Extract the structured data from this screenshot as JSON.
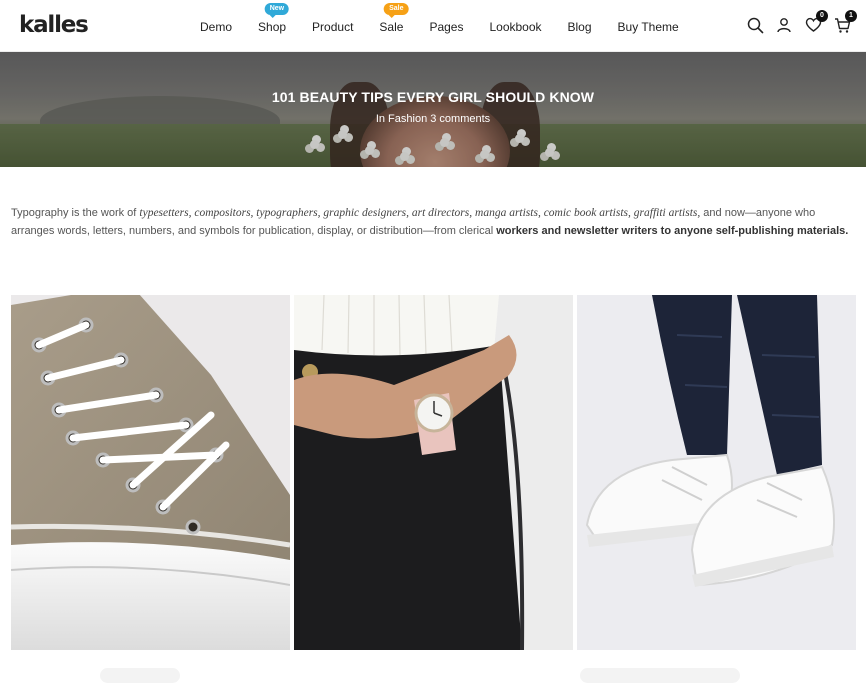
{
  "header": {
    "logo": "kalles",
    "nav": [
      {
        "label": "Demo"
      },
      {
        "label": "Shop",
        "badge": "New",
        "badge_color": "#30a9d8"
      },
      {
        "label": "Product"
      },
      {
        "label": "Sale",
        "badge": "Sale",
        "badge_color": "#f6a116"
      },
      {
        "label": "Pages"
      },
      {
        "label": "Lookbook"
      },
      {
        "label": "Blog"
      },
      {
        "label": "Buy Theme"
      }
    ],
    "icons": {
      "search": "search-icon",
      "account": "user-icon",
      "wishlist": "heart-icon",
      "cart": "cart-icon"
    },
    "wishlist_count": "0",
    "cart_count": "1"
  },
  "hero": {
    "title": "101 BEAUTY TIPS EVERY GIRL SHOULD KNOW",
    "meta": "In Fashion 3 comments"
  },
  "article": {
    "intro_start": "Typography is the work of ",
    "intro_italic": "typesetters, compositors, typographers, graphic designers, art directors, manga artists, comic book artists, graffiti artists,",
    "intro_middle": " and now—anyone who arranges words, letters, numbers, and symbols for publication, display, or distribution—from clerical ",
    "intro_bold": "workers and newsletter writers to anyone self-publishing materials."
  },
  "gallery": {
    "images": [
      "high-top-sneaker-photo",
      "wristwatch-photo",
      "white-sneakers-photo"
    ]
  },
  "colors": {
    "text": "#222222",
    "muted": "#555555",
    "badge_new": "#30a9d8",
    "badge_sale": "#f6a116"
  }
}
